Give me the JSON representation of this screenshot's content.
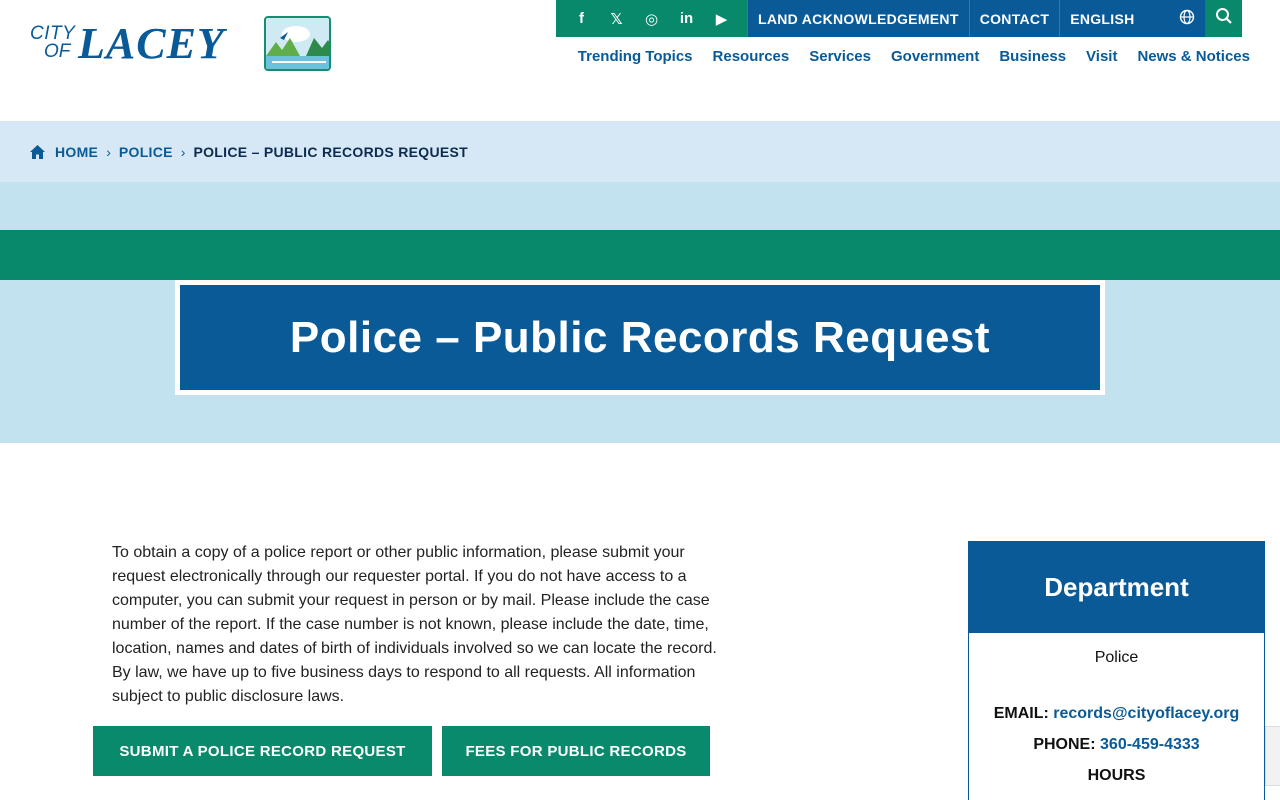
{
  "header": {
    "logo": {
      "city": "CITY",
      "of": "OF",
      "name": "LACEY"
    },
    "social": [
      {
        "icon": "facebook-icon",
        "glyph": "f"
      },
      {
        "icon": "x-twitter-icon",
        "glyph": "𝕏"
      },
      {
        "icon": "instagram-icon",
        "glyph": "◎"
      },
      {
        "icon": "linkedin-icon",
        "glyph": "in"
      },
      {
        "icon": "youtube-icon",
        "glyph": "▶"
      }
    ],
    "land_ack": "LAND ACKNOWLEDGEMENT",
    "contact": "CONTACT",
    "language": "ENGLISH",
    "nav": [
      "Trending Topics",
      "Resources",
      "Services",
      "Government",
      "Business",
      "Visit",
      "News & Notices"
    ]
  },
  "breadcrumb": {
    "home": "HOME",
    "items": [
      "POLICE",
      "POLICE – PUBLIC RECORDS REQUEST"
    ]
  },
  "hero": {
    "title": "Police – Public Records Request"
  },
  "main": {
    "paragraph": "To obtain a copy of a police report or other public information, please submit your request electronically through our requester portal. If you do not have access to a computer, you can submit your request in person or by mail. Please include the case number of the report. If the case number is not known, please include the date, time, location, names and dates of birth of individuals involved so we can locate the record. By law, we have up to five business days to respond to all requests.  All information subject to public disclosure laws.",
    "btn_submit": "SUBMIT A POLICE RECORD REQUEST",
    "btn_fees": "FEES FOR PUBLIC RECORDS"
  },
  "sidebar": {
    "title": "Department",
    "department": "Police",
    "email_label": "EMAIL:",
    "email": "records@cityoflacey.org",
    "phone_label": "PHONE:",
    "phone": "360-459-4333",
    "hours_label": "HOURS"
  },
  "colors": {
    "brand_blue": "#0a5a97",
    "brand_green": "#08896c",
    "light_blue": "#c2e2ef"
  }
}
